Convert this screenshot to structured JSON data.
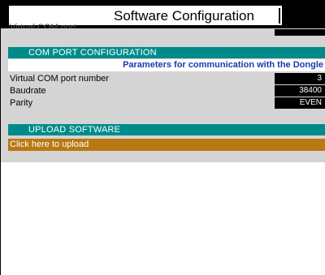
{
  "window": {
    "title": "Software Configuration",
    "clipped_text": "Virtual COM port"
  },
  "com_port": {
    "section_header": "COM PORT CONFIGURATION",
    "subtitle": "Parameters for communication with the Dongle",
    "fields": [
      {
        "label": "Virtual COM port number",
        "value": "3"
      },
      {
        "label": "Baudrate",
        "value": "38400"
      },
      {
        "label": "Parity",
        "value": "EVEN"
      }
    ]
  },
  "upload": {
    "section_header": "UPLOAD SOFTWARE",
    "button_label": "Click here to upload"
  },
  "colors": {
    "section_header_bg": "#008b8b",
    "upload_button_bg": "#b87812",
    "subtitle_text": "#1a3ab0",
    "value_bg": "#000000"
  }
}
